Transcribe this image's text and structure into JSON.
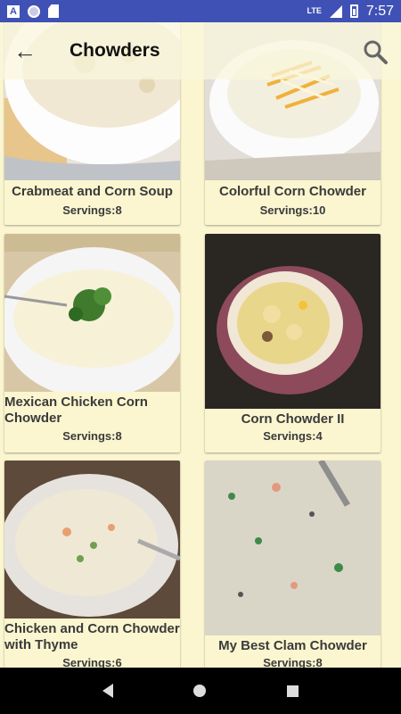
{
  "status_bar": {
    "time": "7:57",
    "network": "LTE",
    "app_icon_letter": "A"
  },
  "app_bar": {
    "title": "Chowders",
    "back_icon": "arrow-back-icon",
    "search_icon": "search-icon"
  },
  "recipes": [
    {
      "title": "Crabmeat and Corn Soup",
      "servings": "Servings:8"
    },
    {
      "title": "Colorful Corn Chowder",
      "servings": "Servings:10"
    },
    {
      "title": "Mexican Chicken Corn Chowder",
      "servings": "Servings:8"
    },
    {
      "title": "Corn Chowder II",
      "servings": "Servings:4"
    },
    {
      "title": "Chicken and Corn Chowder with Thyme",
      "servings": "Servings:6"
    },
    {
      "title": "My Best Clam Chowder",
      "servings": "Servings:8"
    }
  ],
  "colors": {
    "status_bar": "#3F51B5",
    "background": "#FBF6D0",
    "nav_bar": "#000000"
  }
}
